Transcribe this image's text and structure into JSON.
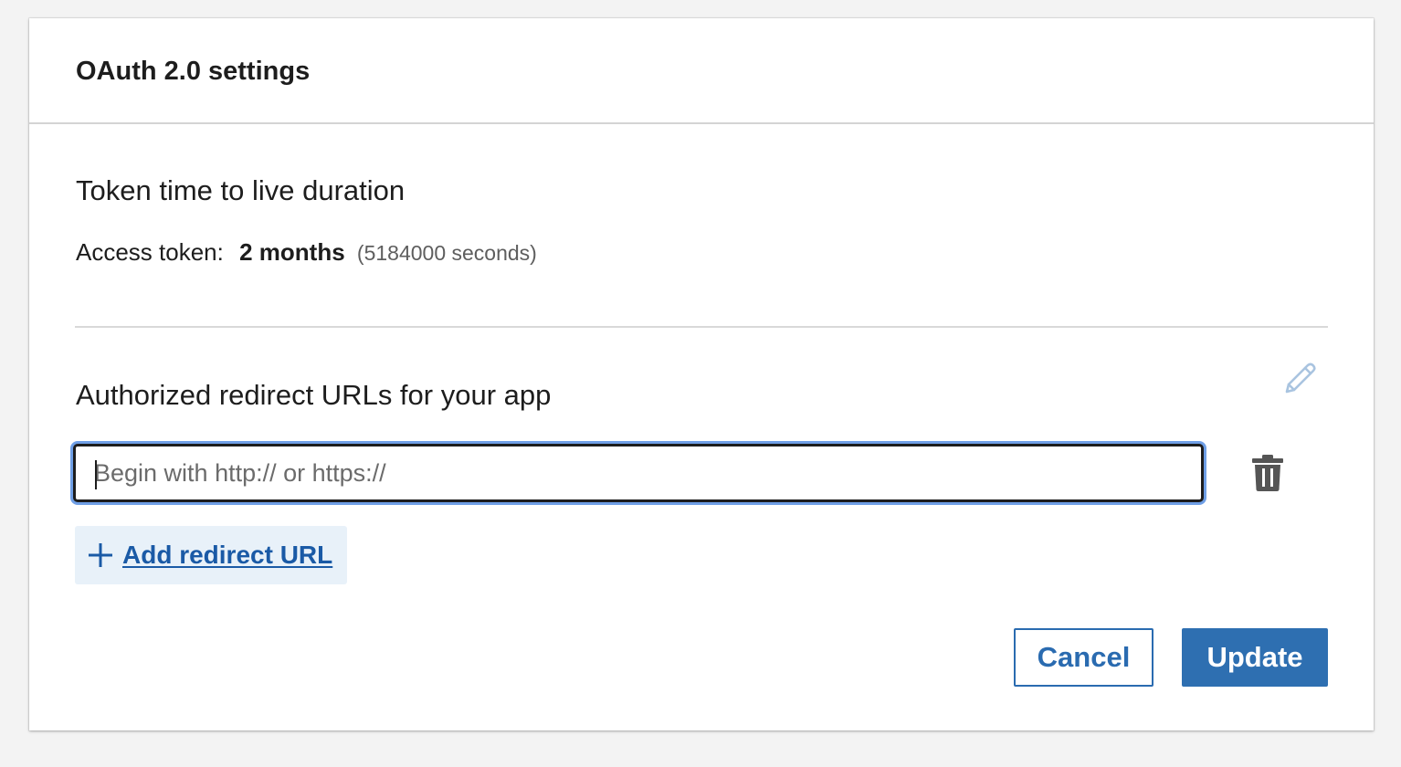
{
  "panel": {
    "title": "OAuth 2.0 settings"
  },
  "token": {
    "section_title": "Token time to live duration",
    "label": "Access token:",
    "value": "2 months",
    "seconds": "(5184000 seconds)"
  },
  "redirect": {
    "section_title": "Authorized redirect URLs for your app",
    "input_value": "",
    "input_placeholder": "Begin with http:// or https://",
    "add_label": "Add redirect URL",
    "edit_icon": "pencil-icon",
    "delete_icon": "trash-icon",
    "add_icon": "plus-icon"
  },
  "actions": {
    "cancel_label": "Cancel",
    "update_label": "Update"
  },
  "colors": {
    "primary": "#2e6fb1",
    "link": "#1a5aa6",
    "focus_ring": "#6f9fe6",
    "add_button_bg": "#e8f1f9",
    "edit_icon": "#a9c4e0"
  }
}
